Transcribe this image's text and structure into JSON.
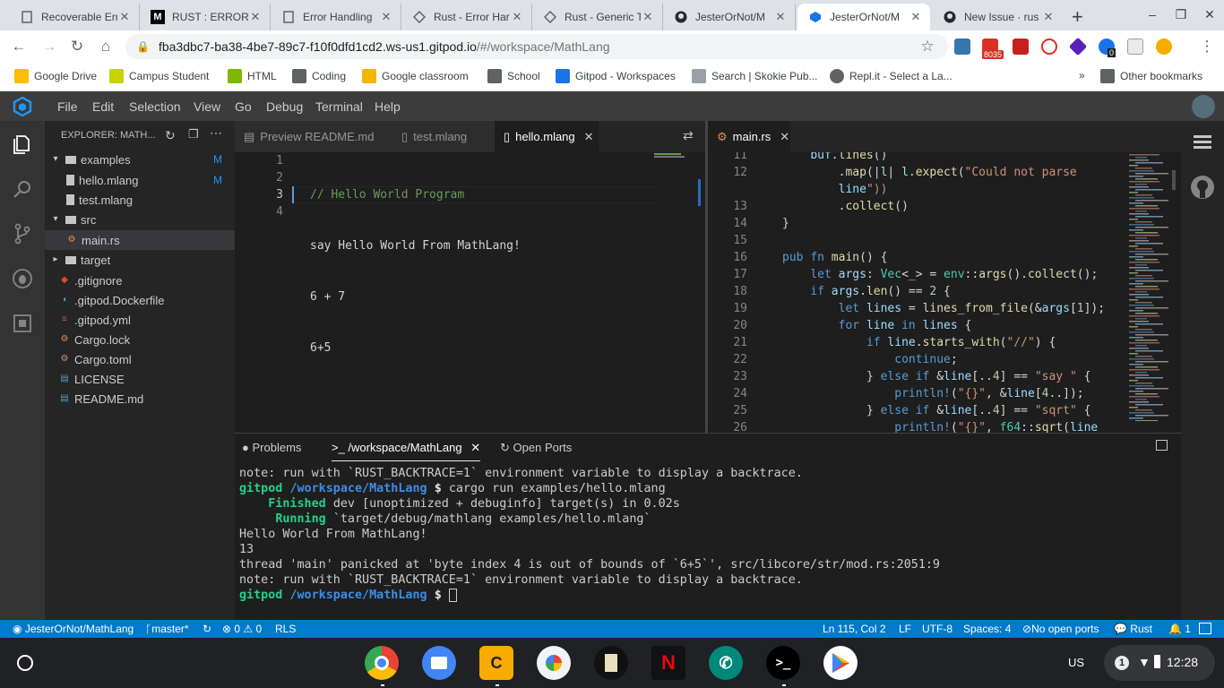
{
  "browser": {
    "tabs": [
      {
        "title": "Recoverable Err",
        "icon": "rust-doc-icon"
      },
      {
        "title": "RUST : ERROR H",
        "icon": "medium-icon"
      },
      {
        "title": "Error Handling",
        "icon": "rust-doc-icon"
      },
      {
        "title": "Rust - Error Har",
        "icon": "tutorialspoint-icon"
      },
      {
        "title": "Rust - Generic T",
        "icon": "tutorialspoint-icon"
      },
      {
        "title": "JesterOrNot/M",
        "icon": "github-icon"
      },
      {
        "title": "JesterOrNot/M",
        "icon": "gitpod-icon",
        "active": true
      },
      {
        "title": "New Issue · rus",
        "icon": "github-icon"
      }
    ],
    "address": {
      "host": "fba3dbc7-ba38-4be7-89c7-f10f0dfd1cd2.ws-us1.gitpod.io",
      "path": "/#/workspace/MathLang"
    },
    "gmail_count": "8035",
    "ext_badge": "0",
    "bookmarks": [
      {
        "label": "Google Drive",
        "color": "#fbbc04"
      },
      {
        "label": "Campus Student",
        "color": "#c8d400"
      },
      {
        "label": "HTML",
        "color": "#7fb800"
      },
      {
        "label": "Coding",
        "color": "#5f6368"
      },
      {
        "label": "Google classroom",
        "color": "#f4b400"
      },
      {
        "label": "School",
        "color": "#5f6368"
      },
      {
        "label": "Gitpod - Workspaces",
        "color": "#1a73e8"
      },
      {
        "label": "Search | Skokie Pub...",
        "color": "#9aa0a6"
      },
      {
        "label": "Repl.it - Select a La...",
        "color": "#5f6368"
      }
    ],
    "other_bookmarks": "Other bookmarks"
  },
  "ide": {
    "menus": [
      "File",
      "Edit",
      "Selection",
      "View",
      "Go",
      "Debug",
      "Terminal",
      "Help"
    ],
    "explorer_title": "EXPLORER: MATH...",
    "tree": [
      {
        "label": "examples",
        "type": "folder-open",
        "badge": "M"
      },
      {
        "label": "hello.mlang",
        "type": "file",
        "badge": "M"
      },
      {
        "label": "test.mlang",
        "type": "file",
        "badge": ""
      },
      {
        "label": "src",
        "type": "folder-open",
        "badge": ""
      },
      {
        "label": "main.rs",
        "type": "rust",
        "badge": "",
        "selected": true
      },
      {
        "label": "target",
        "type": "folder-closed",
        "badge": ""
      },
      {
        "label": ".gitignore",
        "type": "git",
        "badge": ""
      },
      {
        "label": ".gitpod.Dockerfile",
        "type": "docker",
        "badge": ""
      },
      {
        "label": ".gitpod.yml",
        "type": "yml",
        "badge": ""
      },
      {
        "label": "Cargo.lock",
        "type": "rust",
        "badge": ""
      },
      {
        "label": "Cargo.toml",
        "type": "rust",
        "badge": ""
      },
      {
        "label": "LICENSE",
        "type": "doc",
        "badge": ""
      },
      {
        "label": "README.md",
        "type": "doc",
        "badge": ""
      }
    ],
    "editor1_tabs": [
      "Preview README.md",
      "test.mlang",
      "hello.mlang"
    ],
    "editor2_tabs": [
      "main.rs"
    ],
    "hello_lines": [
      {
        "n": "1",
        "text": "// Hello World Program"
      },
      {
        "n": "2",
        "text": "say Hello World From MathLang!"
      },
      {
        "n": "3",
        "text": "6 + 7"
      },
      {
        "n": "4",
        "text": "6+5"
      }
    ],
    "main_rs_lines": [
      {
        "n": "11",
        "text": "    buf.lines()"
      },
      {
        "n": "12",
        "text": "        .map(|l| l.expect(\"Could not parse"
      },
      {
        "n": "",
        "text": "        line\"))"
      },
      {
        "n": "13",
        "text": "        .collect()"
      },
      {
        "n": "14",
        "text": "}"
      },
      {
        "n": "15",
        "text": ""
      },
      {
        "n": "16",
        "text": "pub fn main() {"
      },
      {
        "n": "17",
        "text": "    let args: Vec<_> = env::args().collect();"
      },
      {
        "n": "18",
        "text": "    if args.len() == 2 {"
      },
      {
        "n": "19",
        "text": "        let lines = lines_from_file(&args[1]);"
      },
      {
        "n": "20",
        "text": "        for line in lines {"
      },
      {
        "n": "21",
        "text": "            if line.starts_with(\"//\") {"
      },
      {
        "n": "22",
        "text": "                continue;"
      },
      {
        "n": "23",
        "text": "            } else if &line[..4] == \"say \" {"
      },
      {
        "n": "24",
        "text": "                println!(\"{}\", &line[4..]);"
      },
      {
        "n": "25",
        "text": "            } else if &line[..4] == \"sqrt\" {"
      },
      {
        "n": "26",
        "text": "                println!(\"{}\", f64::sqrt(line"
      }
    ],
    "panel_tabs": [
      "Problems",
      ">_ /workspace/MathLang",
      "Open Ports"
    ],
    "terminal": {
      "l1": "note: run with `RUST_BACKTRACE=1` environment variable to display a backtrace.",
      "prompt_user": "gitpod",
      "prompt_path": "/workspace/MathLang",
      "prompt_sym": "$",
      "cmd": "cargo run examples/hello.mlang",
      "finished_kw": "Finished",
      "finished_rest": "dev [unoptimized + debuginfo] target(s) in 0.02s",
      "running_kw": "Running",
      "running_rest": "`target/debug/mathlang examples/hello.mlang`",
      "out1": "Hello World From MathLang!",
      "out2": "13",
      "panic": "thread 'main' panicked at 'byte index 4 is out of bounds of `6+5`', src/libcore/str/mod.rs:2051:9",
      "l2": "note: run with `RUST_BACKTRACE=1` environment variable to display a backtrace."
    },
    "status": {
      "repo": "JesterOrNot/MathLang",
      "branch": "master*",
      "errors": "0",
      "warnings": "0",
      "rls": "RLS",
      "position": "Ln 115, Col 2",
      "eol": "LF",
      "encoding": "UTF-8",
      "spaces": "Spaces: 4",
      "ports": "No open ports",
      "lang": "Rust",
      "notifications": "1"
    }
  },
  "shelf": {
    "apps": [
      "chrome-icon",
      "files-icon",
      "c-app-icon",
      "photos-icon",
      "castle-icon",
      "netflix-icon",
      "phone-icon",
      "terminal-icon",
      "play-store-icon"
    ],
    "locale": "US",
    "badge": "1",
    "time": "12:28"
  }
}
